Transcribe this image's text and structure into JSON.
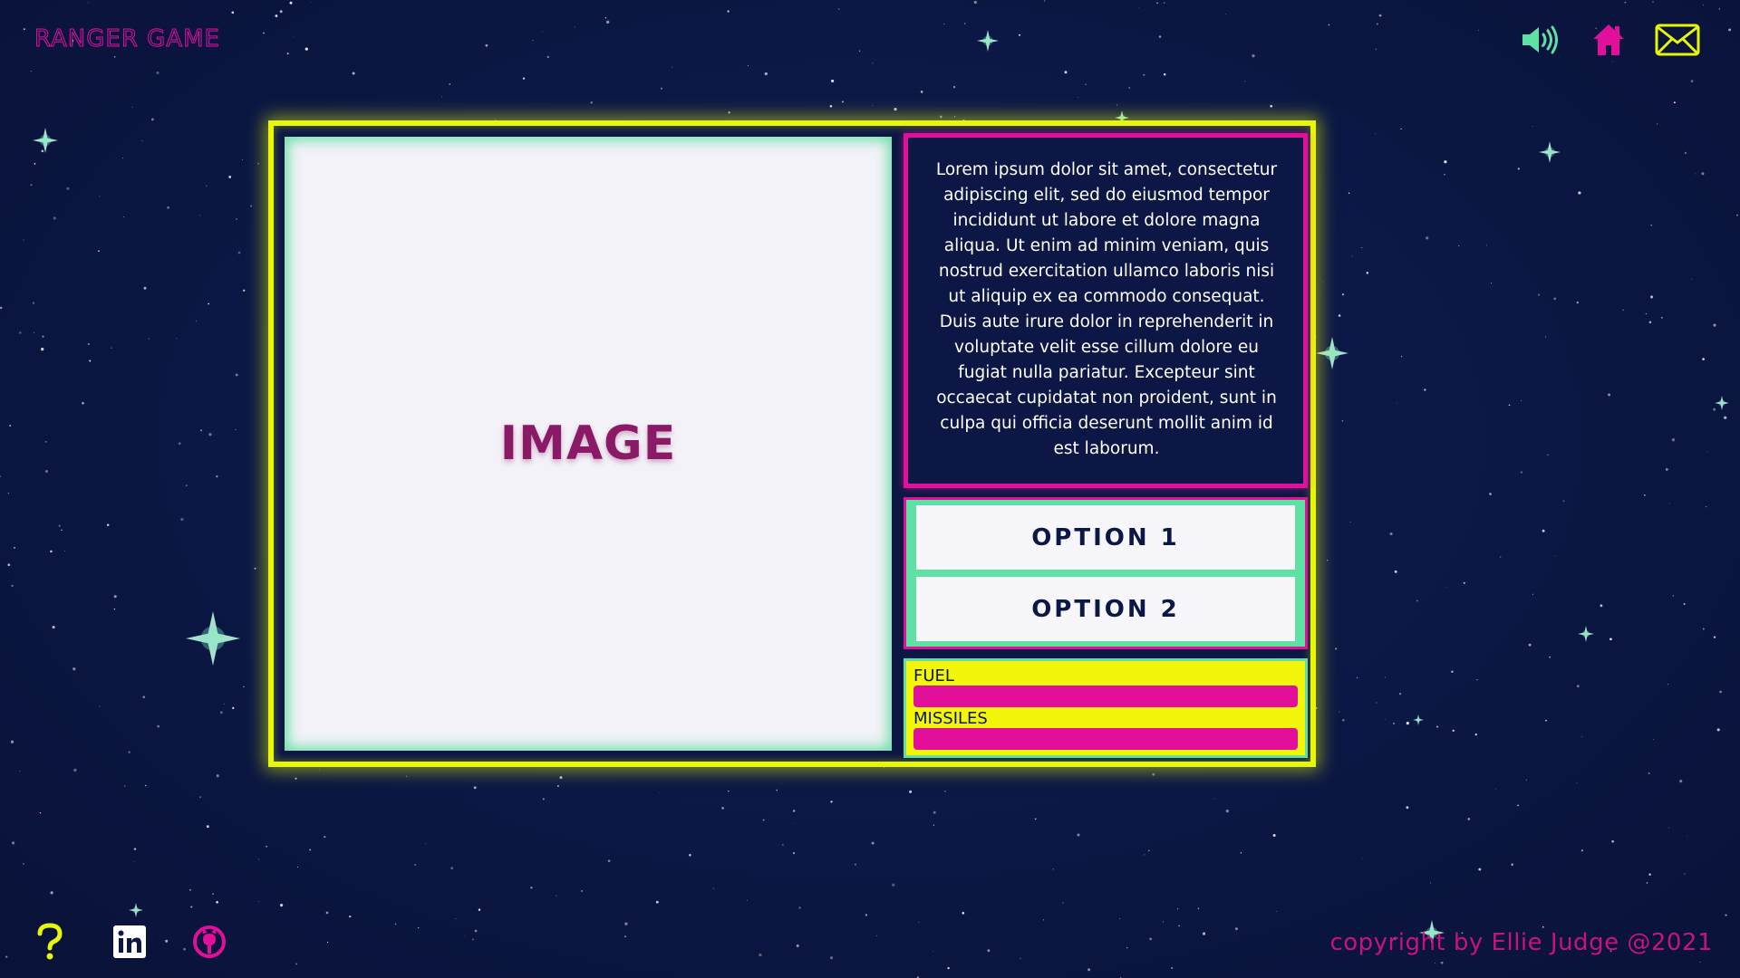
{
  "app": {
    "title": "RANGER GAME"
  },
  "header": {
    "icons": [
      "speaker-icon",
      "home-icon",
      "mail-icon"
    ],
    "colors": {
      "speaker": "#5fe0a5",
      "home": "#e20f9b",
      "mail": "#e8f60a"
    }
  },
  "main": {
    "image_placeholder": "IMAGE",
    "story_text": "Lorem ipsum dolor sit amet, consectetur adipiscing elit, sed do eiusmod tempor incididunt ut labore et dolore magna aliqua. Ut enim ad minim veniam, quis nostrud exercitation ullamco laboris nisi ut aliquip ex ea commodo consequat. Duis aute irure dolor in reprehenderit in voluptate velit esse cillum dolore eu fugiat nulla pariatur. Excepteur sint occaecat cupidatat non proident, sunt in culpa qui officia deserunt mollit anim id est laborum.",
    "options": {
      "option1": "OPTION 1",
      "option2": "OPTION 2"
    },
    "gauges": {
      "fuel": {
        "label": "FUEL",
        "level": 1.0
      },
      "missiles": {
        "label": "MISSILES",
        "level": 1.0
      }
    }
  },
  "footer": {
    "icons": [
      "help-icon",
      "linkedin-icon",
      "github-icon"
    ],
    "copyright": "copyright by Ellie Judge @2021"
  },
  "colors": {
    "background": "#0b1744",
    "frame": "#e8f60a",
    "accent_pink": "#e20f9b",
    "accent_green": "#5fe0a5"
  }
}
